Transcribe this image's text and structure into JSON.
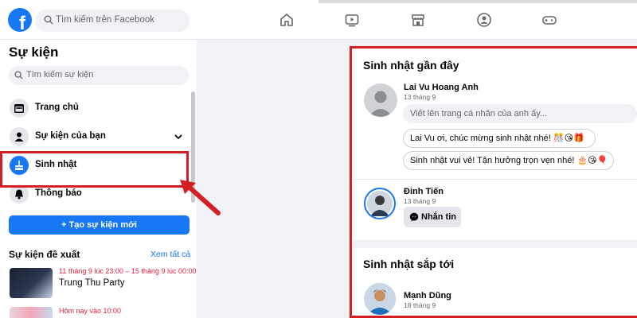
{
  "topbar": {
    "logo": "f",
    "search_placeholder": "Tìm kiếm trên Facebook",
    "nav_icons": [
      "home-icon",
      "watch-icon",
      "marketplace-icon",
      "groups-icon",
      "gaming-icon"
    ]
  },
  "sidebar": {
    "title": "Sự kiện",
    "search_placeholder": "Tìm kiếm sự kiện",
    "items": [
      {
        "label": "Trang chủ",
        "icon": "calendar-icon"
      },
      {
        "label": "Sự kiện của bạn",
        "icon": "person-icon"
      },
      {
        "label": "Sinh nhật",
        "icon": "cake-icon"
      },
      {
        "label": "Thông báo",
        "icon": "bell-icon"
      }
    ],
    "create_button": "+ Tạo sự kiện mới",
    "suggested_title": "Sự kiện đề xuất",
    "see_all": "Xem tất cả",
    "events": [
      {
        "date": "11 tháng 9 lúc 23:00 – 15 tháng 9 lúc 00:00",
        "name": "Trung Thu Party"
      },
      {
        "date": "Hôm nay vào 10:00",
        "name": ""
      }
    ]
  },
  "recent": {
    "title": "Sinh nhật gần đây",
    "person1": {
      "name": "Lai Vu Hoang Anh",
      "date": "13 tháng 9",
      "post_placeholder": "Viết lên trang cá nhân của anh ấy...",
      "suggestions": [
        "Lai Vu ơi, chúc mừng sinh nhật nhé! 🎊😘🎁",
        "Sinh nhật vui vẻ! Tận hưởng trọn vẹn nhé! 🎂😘🎈"
      ]
    },
    "person2": {
      "name": "Đinh Tiến",
      "date": "13 tháng 9",
      "message_button": "Nhắn tin"
    }
  },
  "upcoming": {
    "title": "Sinh nhật sắp tới",
    "person": {
      "name": "Mạnh Dũng",
      "date": "18 tháng 9"
    }
  },
  "colors": {
    "brand": "#1877f2",
    "highlight": "#d42024",
    "event_date": "#e41e3f"
  }
}
